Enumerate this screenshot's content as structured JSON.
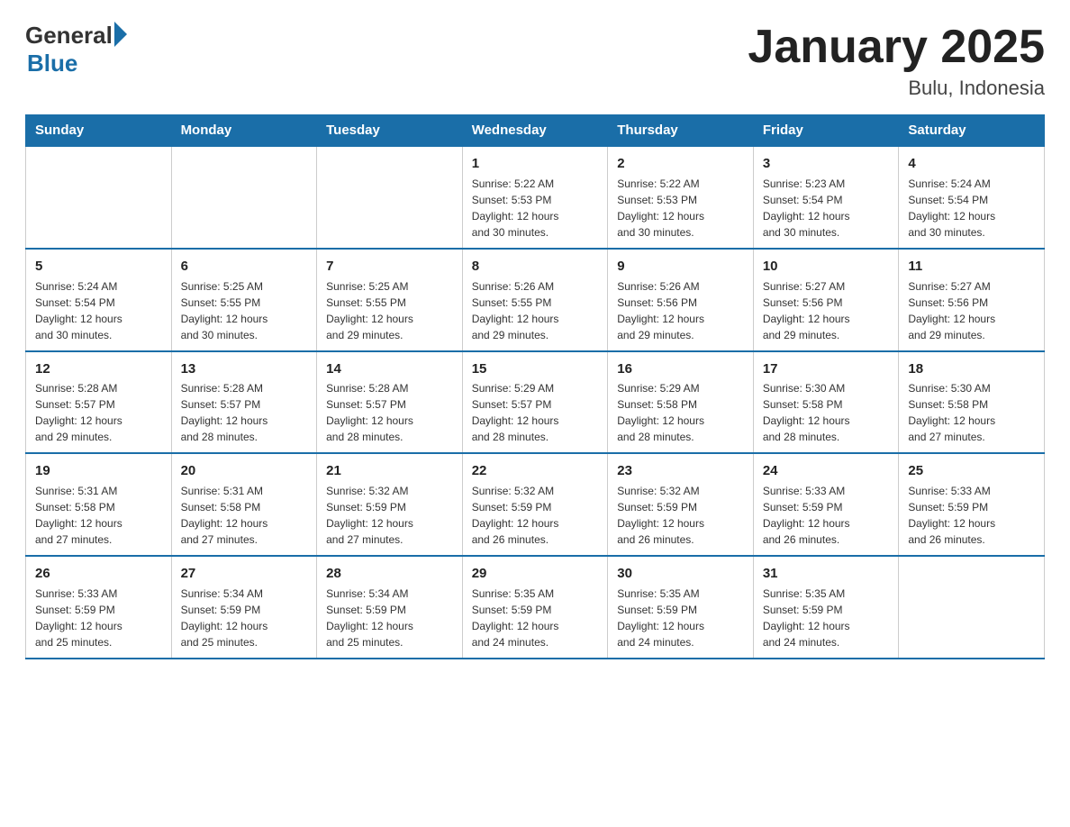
{
  "header": {
    "logo_general": "General",
    "logo_blue": "Blue",
    "title": "January 2025",
    "subtitle": "Bulu, Indonesia"
  },
  "days_of_week": [
    "Sunday",
    "Monday",
    "Tuesday",
    "Wednesday",
    "Thursday",
    "Friday",
    "Saturday"
  ],
  "weeks": [
    [
      {
        "day": "",
        "info": ""
      },
      {
        "day": "",
        "info": ""
      },
      {
        "day": "",
        "info": ""
      },
      {
        "day": "1",
        "info": "Sunrise: 5:22 AM\nSunset: 5:53 PM\nDaylight: 12 hours\nand 30 minutes."
      },
      {
        "day": "2",
        "info": "Sunrise: 5:22 AM\nSunset: 5:53 PM\nDaylight: 12 hours\nand 30 minutes."
      },
      {
        "day": "3",
        "info": "Sunrise: 5:23 AM\nSunset: 5:54 PM\nDaylight: 12 hours\nand 30 minutes."
      },
      {
        "day": "4",
        "info": "Sunrise: 5:24 AM\nSunset: 5:54 PM\nDaylight: 12 hours\nand 30 minutes."
      }
    ],
    [
      {
        "day": "5",
        "info": "Sunrise: 5:24 AM\nSunset: 5:54 PM\nDaylight: 12 hours\nand 30 minutes."
      },
      {
        "day": "6",
        "info": "Sunrise: 5:25 AM\nSunset: 5:55 PM\nDaylight: 12 hours\nand 30 minutes."
      },
      {
        "day": "7",
        "info": "Sunrise: 5:25 AM\nSunset: 5:55 PM\nDaylight: 12 hours\nand 29 minutes."
      },
      {
        "day": "8",
        "info": "Sunrise: 5:26 AM\nSunset: 5:55 PM\nDaylight: 12 hours\nand 29 minutes."
      },
      {
        "day": "9",
        "info": "Sunrise: 5:26 AM\nSunset: 5:56 PM\nDaylight: 12 hours\nand 29 minutes."
      },
      {
        "day": "10",
        "info": "Sunrise: 5:27 AM\nSunset: 5:56 PM\nDaylight: 12 hours\nand 29 minutes."
      },
      {
        "day": "11",
        "info": "Sunrise: 5:27 AM\nSunset: 5:56 PM\nDaylight: 12 hours\nand 29 minutes."
      }
    ],
    [
      {
        "day": "12",
        "info": "Sunrise: 5:28 AM\nSunset: 5:57 PM\nDaylight: 12 hours\nand 29 minutes."
      },
      {
        "day": "13",
        "info": "Sunrise: 5:28 AM\nSunset: 5:57 PM\nDaylight: 12 hours\nand 28 minutes."
      },
      {
        "day": "14",
        "info": "Sunrise: 5:28 AM\nSunset: 5:57 PM\nDaylight: 12 hours\nand 28 minutes."
      },
      {
        "day": "15",
        "info": "Sunrise: 5:29 AM\nSunset: 5:57 PM\nDaylight: 12 hours\nand 28 minutes."
      },
      {
        "day": "16",
        "info": "Sunrise: 5:29 AM\nSunset: 5:58 PM\nDaylight: 12 hours\nand 28 minutes."
      },
      {
        "day": "17",
        "info": "Sunrise: 5:30 AM\nSunset: 5:58 PM\nDaylight: 12 hours\nand 28 minutes."
      },
      {
        "day": "18",
        "info": "Sunrise: 5:30 AM\nSunset: 5:58 PM\nDaylight: 12 hours\nand 27 minutes."
      }
    ],
    [
      {
        "day": "19",
        "info": "Sunrise: 5:31 AM\nSunset: 5:58 PM\nDaylight: 12 hours\nand 27 minutes."
      },
      {
        "day": "20",
        "info": "Sunrise: 5:31 AM\nSunset: 5:58 PM\nDaylight: 12 hours\nand 27 minutes."
      },
      {
        "day": "21",
        "info": "Sunrise: 5:32 AM\nSunset: 5:59 PM\nDaylight: 12 hours\nand 27 minutes."
      },
      {
        "day": "22",
        "info": "Sunrise: 5:32 AM\nSunset: 5:59 PM\nDaylight: 12 hours\nand 26 minutes."
      },
      {
        "day": "23",
        "info": "Sunrise: 5:32 AM\nSunset: 5:59 PM\nDaylight: 12 hours\nand 26 minutes."
      },
      {
        "day": "24",
        "info": "Sunrise: 5:33 AM\nSunset: 5:59 PM\nDaylight: 12 hours\nand 26 minutes."
      },
      {
        "day": "25",
        "info": "Sunrise: 5:33 AM\nSunset: 5:59 PM\nDaylight: 12 hours\nand 26 minutes."
      }
    ],
    [
      {
        "day": "26",
        "info": "Sunrise: 5:33 AM\nSunset: 5:59 PM\nDaylight: 12 hours\nand 25 minutes."
      },
      {
        "day": "27",
        "info": "Sunrise: 5:34 AM\nSunset: 5:59 PM\nDaylight: 12 hours\nand 25 minutes."
      },
      {
        "day": "28",
        "info": "Sunrise: 5:34 AM\nSunset: 5:59 PM\nDaylight: 12 hours\nand 25 minutes."
      },
      {
        "day": "29",
        "info": "Sunrise: 5:35 AM\nSunset: 5:59 PM\nDaylight: 12 hours\nand 24 minutes."
      },
      {
        "day": "30",
        "info": "Sunrise: 5:35 AM\nSunset: 5:59 PM\nDaylight: 12 hours\nand 24 minutes."
      },
      {
        "day": "31",
        "info": "Sunrise: 5:35 AM\nSunset: 5:59 PM\nDaylight: 12 hours\nand 24 minutes."
      },
      {
        "day": "",
        "info": ""
      }
    ]
  ]
}
